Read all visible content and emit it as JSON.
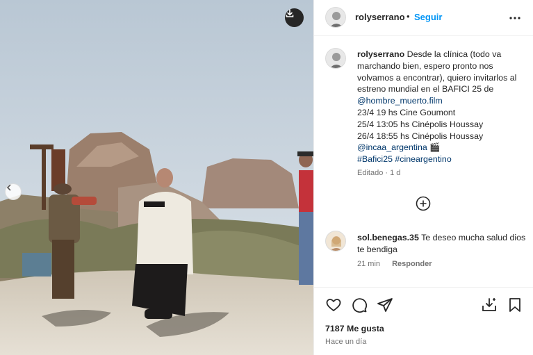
{
  "post": {
    "username": "rolyserrano",
    "separator": "•",
    "follow_label": "Seguir",
    "caption_lines": [
      "Desde la clínica (todo va",
      "marchando bien, espero pronto nos",
      "volvamos a encontrar), quiero",
      "invitarlos al estreno mundial en el",
      "BAFICI 25 de"
    ],
    "mention_film": "@hombre_muerto.film",
    "screenings": [
      "23/4 19 hs Cine Goumont",
      "25/4 13:05 hs Cinépolis Houssay",
      "26/4 18:55 hs Cinépolis Houssay"
    ],
    "mention_incaa": "@incaa_argentina",
    "clapper_emoji": "🎬",
    "hashtags": "#Bafici25 #cineargentino",
    "edited_meta": "Editado · 1 d",
    "likes": "7187 Me gusta",
    "posted_ago": "Hace un día"
  },
  "comment": {
    "username": "sol.benegas.35",
    "text": "Te deseo mucha salud dios te bendiga",
    "time": "21 min",
    "reply_label": "Responder"
  },
  "icons": {
    "download": "download-icon",
    "previous": "chevron-left-icon",
    "more": "more-horizontal-icon",
    "add_comment": "plus-circle-icon",
    "like": "heart-icon",
    "comment": "comment-icon",
    "share": "share-icon",
    "save_collection": "save-to-collection-icon",
    "bookmark": "bookmark-icon"
  },
  "colors": {
    "accent": "#0095f6",
    "link": "#00376b",
    "muted": "#737373"
  }
}
